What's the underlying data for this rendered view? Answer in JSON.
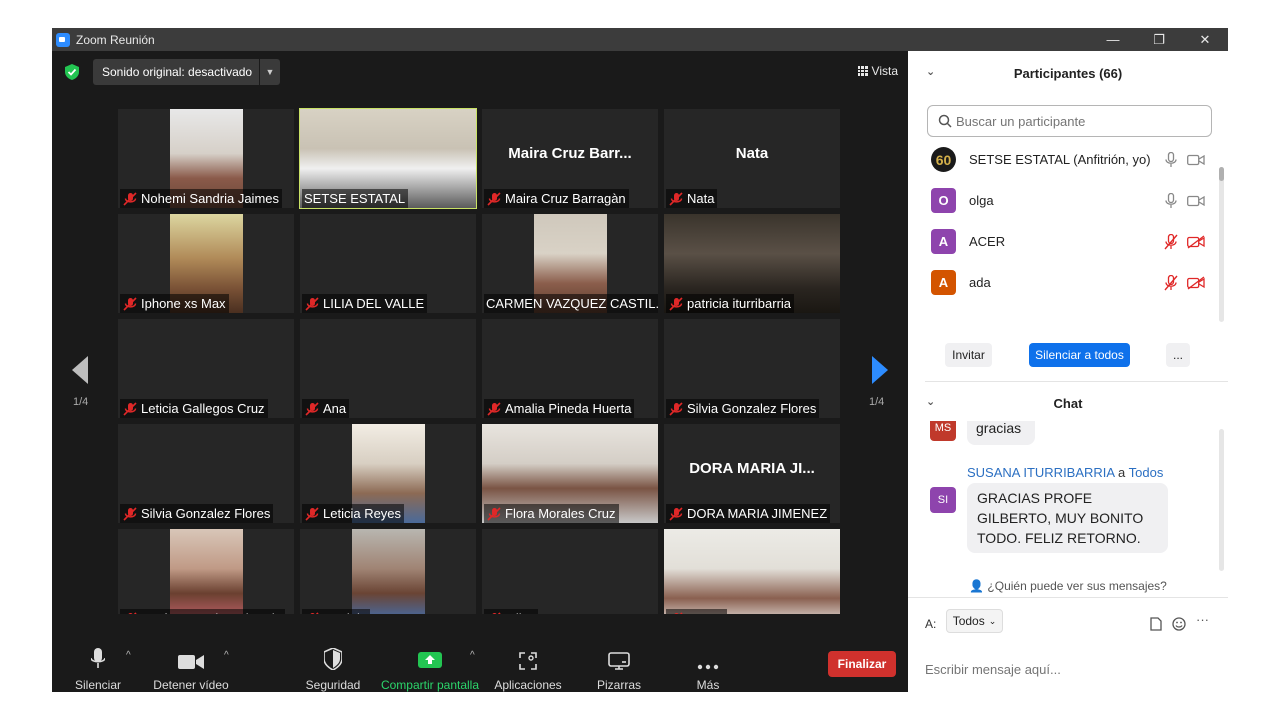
{
  "window": {
    "title": "Zoom Reunión",
    "controls": [
      "—",
      "❐",
      "✕"
    ]
  },
  "topbar": {
    "sound_label": "Sonido original: desactivado",
    "view_label": "Vista"
  },
  "tiles": [
    {
      "name": "Nohemi Sandria Jaimes",
      "big": "",
      "video": true,
      "muted": true
    },
    {
      "name": "SETSE ESTATAL",
      "big": "",
      "video": true,
      "muted": false,
      "active": true
    },
    {
      "name": "Maira Cruz Barragàn",
      "big": "Maira Cruz Barr...",
      "video": false,
      "muted": true
    },
    {
      "name": "Nata",
      "big": "Nata",
      "video": false,
      "muted": true
    },
    {
      "name": "Iphone xs Max",
      "big": "",
      "video": true,
      "muted": true
    },
    {
      "name": "LILIA DEL VALLE",
      "big": "",
      "video": false,
      "muted": true
    },
    {
      "name": "CARMEN VAZQUEZ CASTIL...",
      "big": "",
      "video": true,
      "muted": false
    },
    {
      "name": "patricia iturribarria",
      "big": "",
      "video": true,
      "muted": true
    },
    {
      "name": "Leticia Gallegos Cruz",
      "big": "",
      "video": false,
      "muted": true
    },
    {
      "name": "Ana",
      "big": "",
      "video": false,
      "muted": true
    },
    {
      "name": "Amalia Pineda Huerta",
      "big": "",
      "video": false,
      "muted": true
    },
    {
      "name": "Silvia Gonzalez Flores",
      "big": "",
      "video": false,
      "muted": true
    },
    {
      "name": "Silvia Gonzalez Flores",
      "big": "",
      "video": false,
      "muted": true
    },
    {
      "name": "Leticia Reyes",
      "big": "",
      "video": true,
      "muted": true
    },
    {
      "name": "Flora Morales Cruz",
      "big": "",
      "video": true,
      "muted": true
    },
    {
      "name": "DORA MARIA JIMENEZ",
      "big": "DORA MARIA JI...",
      "video": false,
      "muted": true
    },
    {
      "name": "María Eugenia Colorado",
      "big": "",
      "video": true,
      "muted": true
    },
    {
      "name": "Daniela",
      "big": "",
      "video": true,
      "muted": true
    },
    {
      "name": "Milca",
      "big": "",
      "video": false,
      "muted": true
    },
    {
      "name": "ELIAS",
      "big": "",
      "video": true,
      "muted": true
    }
  ],
  "pagination": {
    "left": "1/4",
    "right": "1/4"
  },
  "toolbar": {
    "mute": "Silenciar",
    "video": "Detener vídeo",
    "security": "Seguridad",
    "share": "Compartir pantalla",
    "apps": "Aplicaciones",
    "whiteboards": "Pizarras",
    "more": "Más",
    "end": "Finalizar"
  },
  "participants": {
    "header": "Participantes (66)",
    "search_placeholder": "Buscar un participante",
    "list": [
      {
        "name": "SETSE ESTATAL (Anfitrión, yo)",
        "initial": "60",
        "color": "#1a1a1a",
        "muted": false
      },
      {
        "name": "olga",
        "initial": "O",
        "color": "#8e44ad",
        "muted": false
      },
      {
        "name": "ACER",
        "initial": "A",
        "color": "#8e44ad",
        "muted": true
      },
      {
        "name": "ada",
        "initial": "A",
        "color": "#d35400",
        "muted": true
      }
    ],
    "invite": "Invitar",
    "mute_all": "Silenciar a todos",
    "more": "..."
  },
  "chat": {
    "header": "Chat",
    "prev_msg_initials": "MS",
    "prev_msg_text": "gracias",
    "sender": "SUSANA ITURRIBARRIA",
    "to_word": "a",
    "to_target": "Todos",
    "sender_initials": "SI",
    "message": "GRACIAS PROFE GILBERTO, MUY BONITO TODO. FELIZ RETORNO.",
    "who_can_see": "¿Quién puede ver sus mensajes?",
    "to_label": "A:",
    "to_value": "Todos",
    "input_placeholder": "Escribir mensaje aquí..."
  }
}
